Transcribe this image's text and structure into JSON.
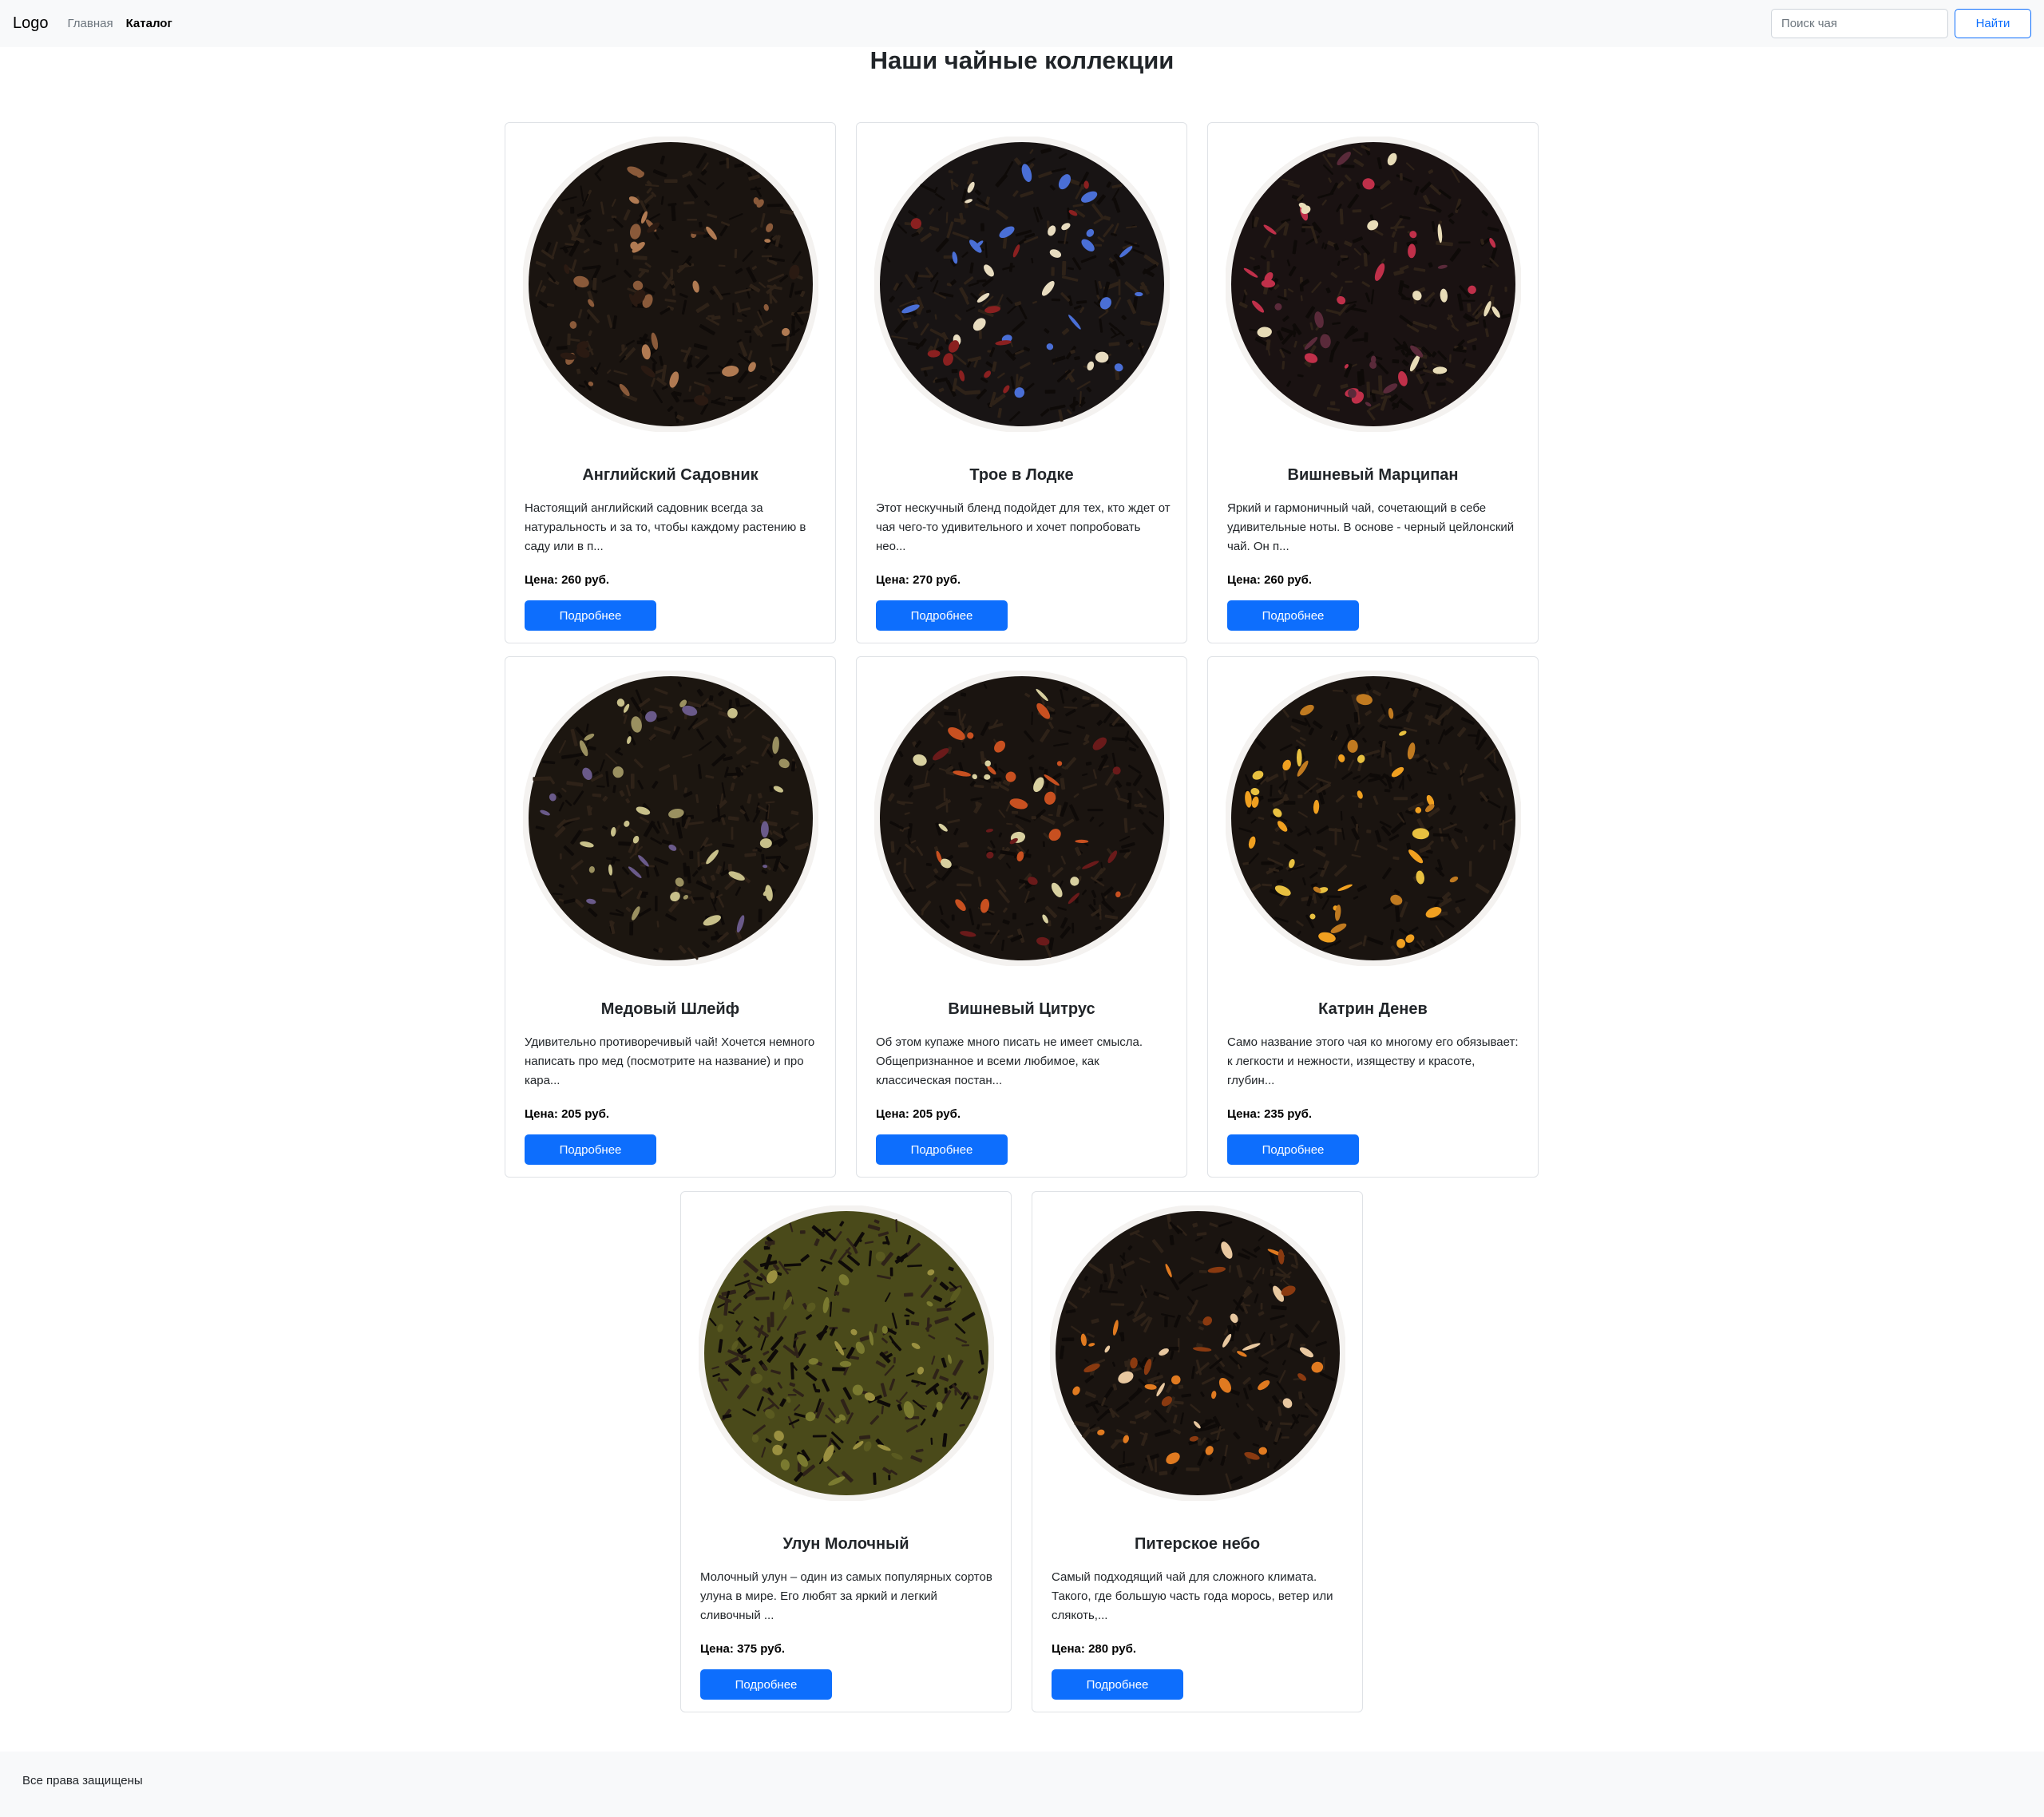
{
  "navbar": {
    "logo": "Logo",
    "links": [
      {
        "label": "Главная",
        "active": false
      },
      {
        "label": "Каталог",
        "active": true
      }
    ],
    "search": {
      "placeholder": "Поиск чая",
      "value": "",
      "button_label": "Найти"
    }
  },
  "page": {
    "title": "Наши чайные коллекции"
  },
  "price_label": "Цена:",
  "products": [
    {
      "name": "Английский Садовник",
      "description": "Настоящий английский садовник всегда за натуральность и за то, чтобы каждому растению в саду или в п...",
      "price": "260 руб.",
      "button": "Подробнее",
      "image": {
        "base": "#1a1410",
        "inclusions": [
          "#8a5a3a",
          "#b07a52",
          "#2a1a12"
        ]
      }
    },
    {
      "name": "Трое в Лодке",
      "description": "Этот нескучный бленд подойдет для тех, кто ждет от чая чего-то удивительного и хочет попробовать нео...",
      "price": "270 руб.",
      "button": "Подробнее",
      "image": {
        "base": "#181414",
        "inclusions": [
          "#4a6fd6",
          "#e8dcc0",
          "#8a2020"
        ]
      }
    },
    {
      "name": "Вишневый Марципан",
      "description": "Яркий и гармоничный чай, сочетающий в себе удивительные ноты. В основе - черный цейлонский чай. Он п...",
      "price": "260 руб.",
      "button": "Подробнее",
      "image": {
        "base": "#1a1212",
        "inclusions": [
          "#c0304a",
          "#e8dcb8",
          "#5a2a3a"
        ]
      }
    },
    {
      "name": "Медовый Шлейф",
      "description": "Удивительно противоречивый чай! Хочется немного написать про мед (посмотрите на название) и про кара...",
      "price": "205 руб.",
      "button": "Подробнее",
      "image": {
        "base": "#1c1610",
        "inclusions": [
          "#c8c08a",
          "#9a9060",
          "#6a5a8a"
        ]
      }
    },
    {
      "name": "Вишневый Цитрус",
      "description": "Об этом купаже много писать не имеет смысла. Общепризнанное и всеми любимое, как классическая постан...",
      "price": "205 руб.",
      "button": "Подробнее",
      "image": {
        "base": "#1a1410",
        "inclusions": [
          "#c85020",
          "#d8d0a0",
          "#6a1a1a"
        ]
      }
    },
    {
      "name": "Катрин Денев",
      "description": "Само название этого чая ко многому его обязывает: к легкости и нежности, изяществу и красоте, глубин...",
      "price": "235 руб.",
      "button": "Подробнее",
      "image": {
        "base": "#1a1410",
        "inclusions": [
          "#f0a020",
          "#e8c040",
          "#c07a20"
        ]
      }
    },
    {
      "name": "Улун Молочный",
      "description": "Молочный улун – один из самых популярных сортов улуна в мире. Его любят за яркий и легкий сливочный ...",
      "price": "375 руб.",
      "button": "Подробнее",
      "image": {
        "base": "#4a4a1a",
        "inclusions": [
          "#7a7a30",
          "#5a5a20",
          "#9a9040"
        ]
      }
    },
    {
      "name": "Питерское небо",
      "description": "Самый подходящий чай для сложного климата. Такого, где большую часть года морось, ветер или слякоть,...",
      "price": "280 руб.",
      "button": "Подробнее",
      "image": {
        "base": "#1a1410",
        "inclusions": [
          "#e07a20",
          "#e8c8a0",
          "#8a3a10"
        ]
      }
    }
  ],
  "footer": {
    "text": "Все права защищены"
  }
}
